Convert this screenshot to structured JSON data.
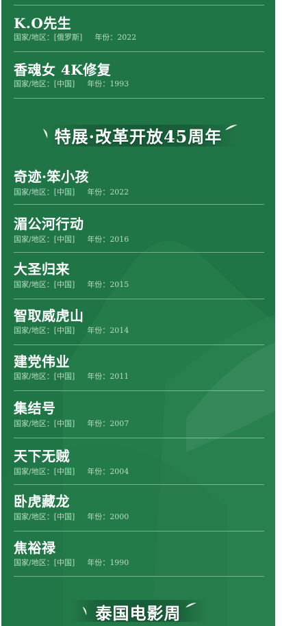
{
  "colors": {
    "background": "#1f7546",
    "divider": "#bee1c8",
    "title_text": "#ffffff",
    "meta_text": "#b9dcc5"
  },
  "labels": {
    "country_prefix": "国家/地区：",
    "year_prefix": "年份："
  },
  "sections": {
    "special_exhibition": "特展·改革开放45周年",
    "thai_film_week": "泰国电影周"
  },
  "films_before": [
    {
      "title": "K.O先生",
      "country": "[俄罗斯]",
      "year": "2022"
    },
    {
      "title": "香魂女 4K修复",
      "country": "[中国]",
      "year": "1993"
    }
  ],
  "films_reform": [
    {
      "title": "奇迹·笨小孩",
      "country": "[中国]",
      "year": "2022"
    },
    {
      "title": "湄公河行动",
      "country": "[中国]",
      "year": "2016"
    },
    {
      "title": "大圣归来",
      "country": "[中国]",
      "year": "2015"
    },
    {
      "title": "智取威虎山",
      "country": "[中国]",
      "year": "2014"
    },
    {
      "title": "建党伟业",
      "country": "[中国]",
      "year": "2011"
    },
    {
      "title": "集结号",
      "country": "[中国]",
      "year": "2007"
    },
    {
      "title": "天下无贼",
      "country": "[中国]",
      "year": "2004"
    },
    {
      "title": "卧虎藏龙",
      "country": "[中国]",
      "year": "2000"
    },
    {
      "title": "焦裕禄",
      "country": "[中国]",
      "year": "1990"
    }
  ]
}
